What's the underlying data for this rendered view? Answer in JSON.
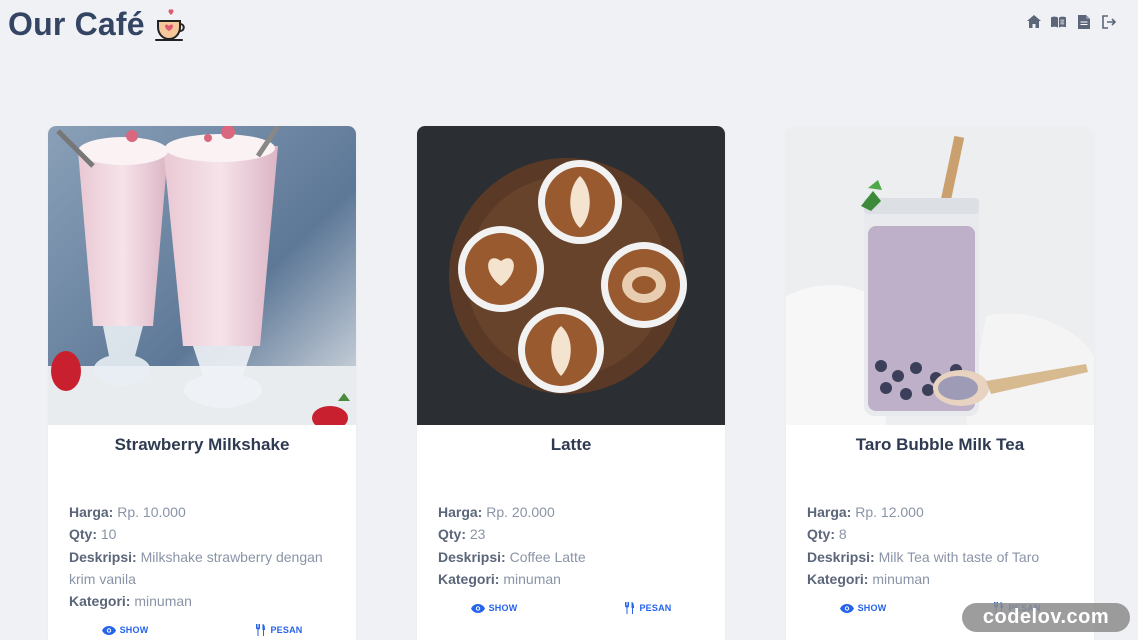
{
  "app": {
    "title": "Our Café"
  },
  "nav": {
    "icons": [
      "home-icon",
      "menu-book-icon",
      "document-icon",
      "logout-icon"
    ]
  },
  "labels": {
    "price": "Harga:",
    "qty": "Qty:",
    "desc": "Deskripsi:",
    "category": "Kategori:"
  },
  "actions": {
    "show": "SHOW",
    "order": "PESAN"
  },
  "products": [
    {
      "name": "Strawberry Milkshake",
      "price": "Rp. 10.000",
      "qty": "10",
      "desc": "Milkshake strawberry dengan krim vanila",
      "category": "minuman"
    },
    {
      "name": "Latte",
      "price": "Rp. 20.000",
      "qty": "23",
      "desc": "Coffee Latte",
      "category": "minuman"
    },
    {
      "name": "Taro Bubble Milk Tea",
      "price": "Rp. 12.000",
      "qty": "8",
      "desc": "Milk Tea with taste of Taro",
      "category": "minuman"
    }
  ],
  "watermark": "codelov.com",
  "colors": {
    "background": "#f0f1f5",
    "accent": "#2563eb",
    "title": "#344563"
  }
}
